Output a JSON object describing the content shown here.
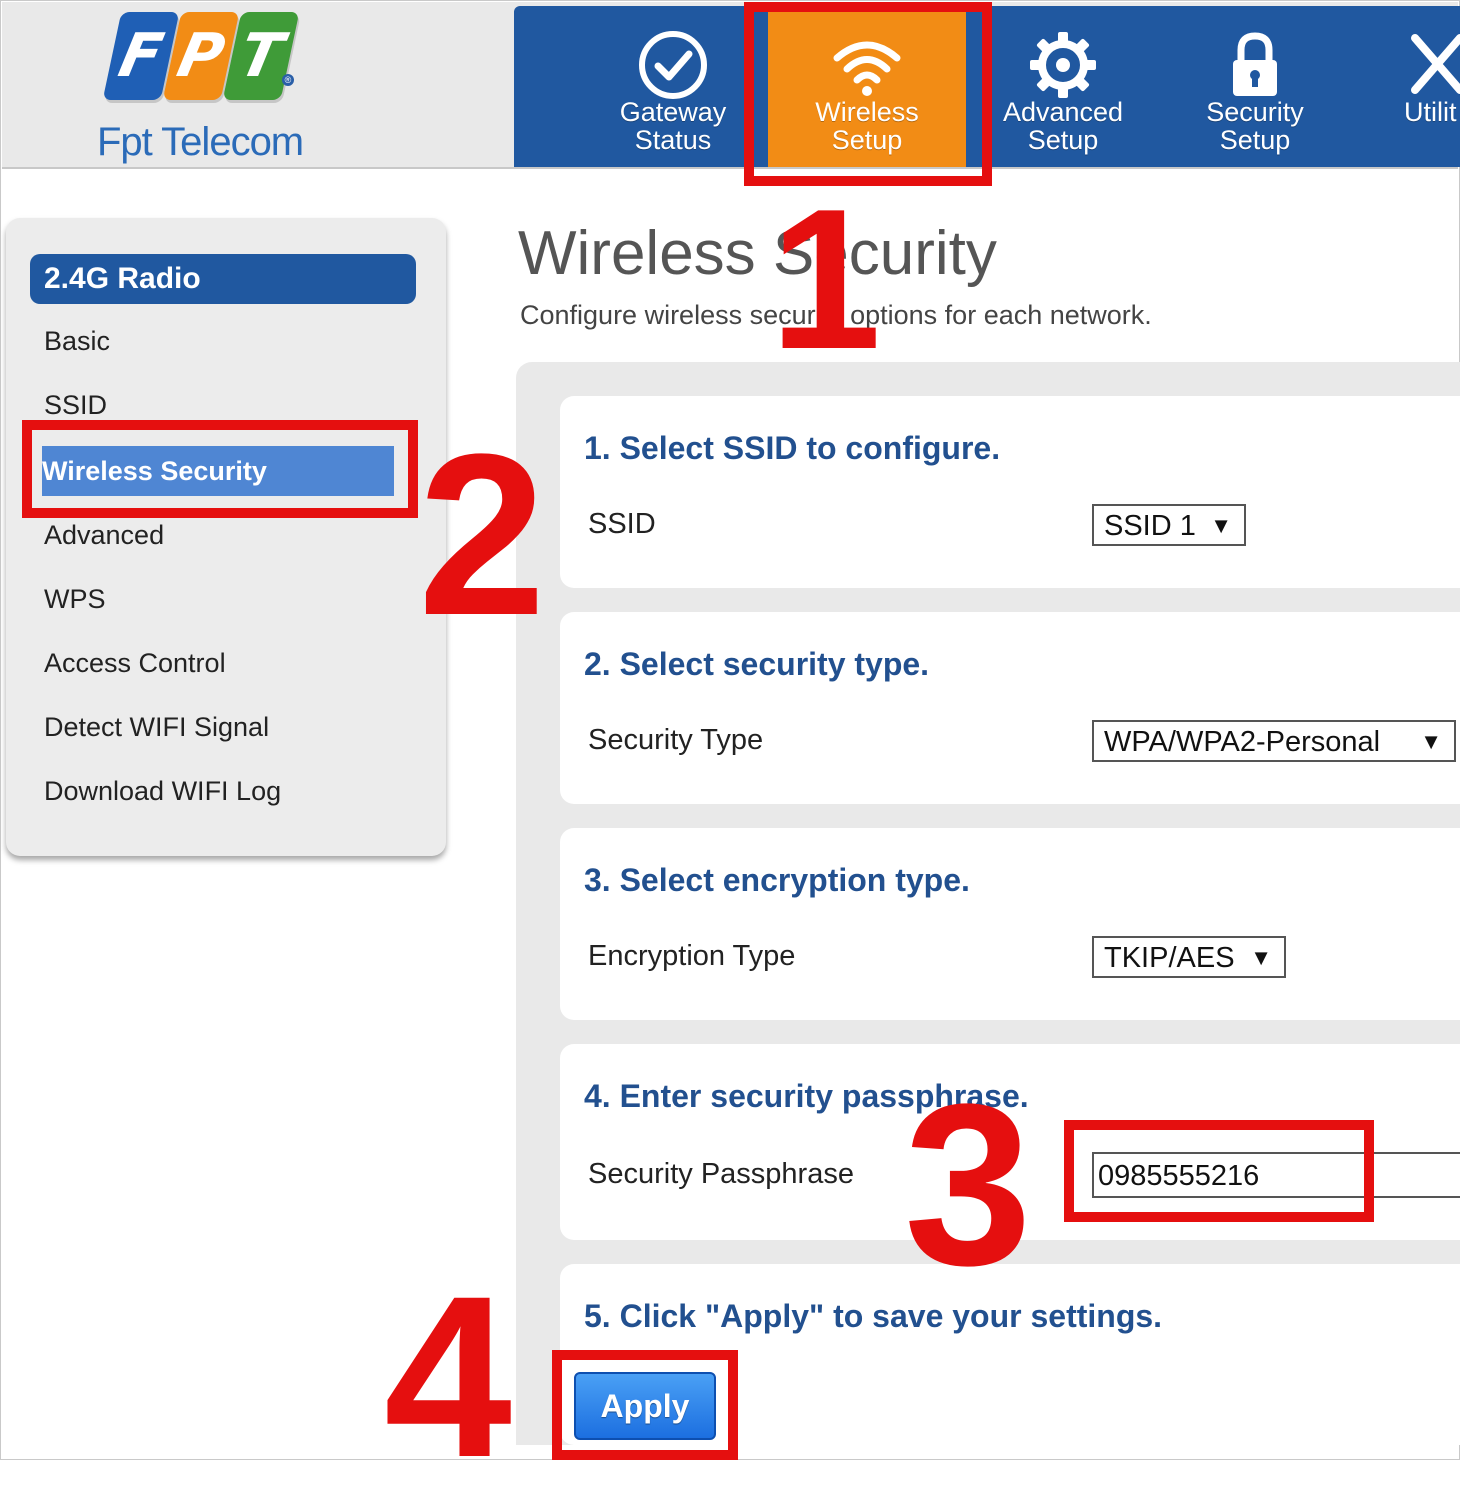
{
  "brand": {
    "letters": [
      "F",
      "P",
      "T"
    ],
    "name": "Fpt Telecom",
    "colors": {
      "blue": "#1f5fb5",
      "orange": "#f28c15",
      "green": "#3f9b38"
    }
  },
  "topnav": {
    "tabs": [
      {
        "label": "Gateway\nStatus",
        "icon": "check-circle-icon"
      },
      {
        "label": "Wireless\nSetup",
        "icon": "wifi-icon",
        "active": true
      },
      {
        "label": "Advanced\nSetup",
        "icon": "gear-icon"
      },
      {
        "label": "Security\nSetup",
        "icon": "lock-icon"
      },
      {
        "label": "Utilit",
        "icon": "tools-icon"
      }
    ]
  },
  "sidebar": {
    "header": "2.4G Radio",
    "items": [
      "Basic",
      "SSID",
      "Wireless Security",
      "Advanced",
      "WPS",
      "Access Control",
      "Detect WIFI Signal",
      "Download WIFI Log"
    ],
    "active_item": "Wireless Security"
  },
  "page": {
    "title": "Wireless Security",
    "subtitle": "Configure wireless security options for each network."
  },
  "steps": {
    "ssid": {
      "title": "1. Select SSID to configure.",
      "label": "SSID",
      "value": "SSID 1"
    },
    "security": {
      "title": "2. Select security type.",
      "label": "Security Type",
      "value": "WPA/WPA2-Personal"
    },
    "encryption": {
      "title": "3. Select encryption type.",
      "label": "Encryption Type",
      "value": "TKIP/AES"
    },
    "passphrase": {
      "title": "4. Enter security passphrase.",
      "label": "Security Passphrase",
      "value": "0985555216"
    },
    "apply": {
      "title": "5. Click \"Apply\" to save your settings.",
      "button": "Apply"
    }
  },
  "annotations": {
    "numbers": [
      "1",
      "2",
      "3",
      "4"
    ],
    "color": "#e50f0f"
  },
  "colors": {
    "nav_blue": "#2058a0",
    "active_orange": "#f28c15",
    "heading_blue": "#22508f"
  }
}
